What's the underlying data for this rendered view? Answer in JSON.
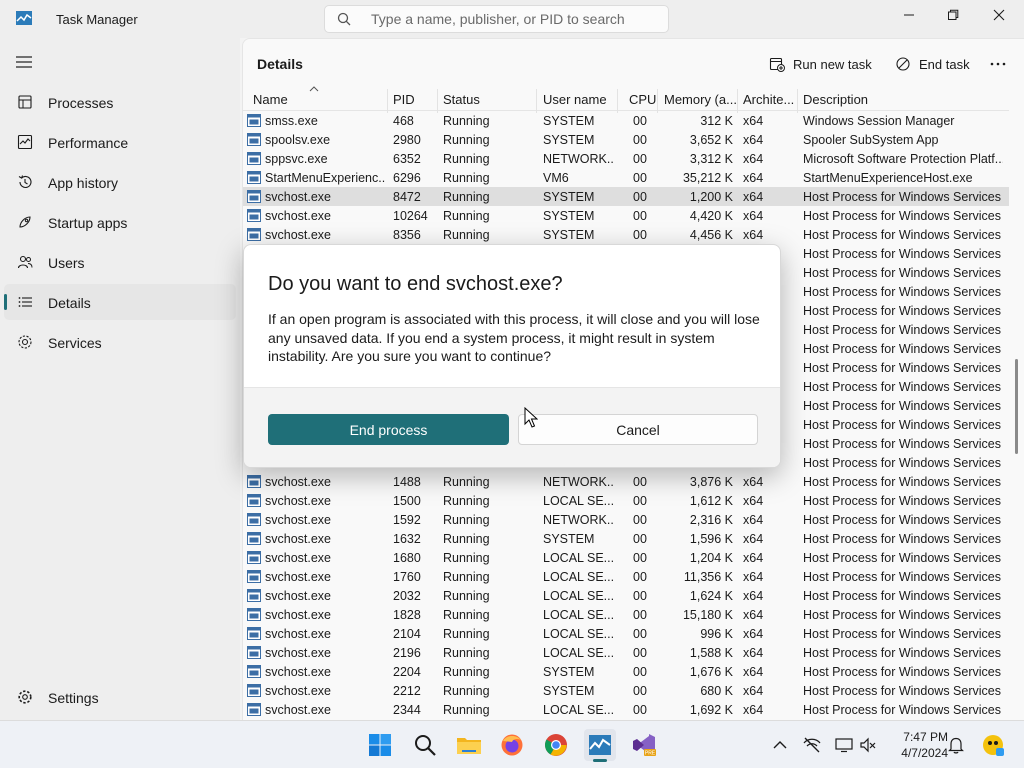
{
  "window": {
    "title": "Task Manager",
    "search_placeholder": "Type a name, publisher, or PID to search"
  },
  "sidebar": {
    "items": [
      {
        "label": "Processes",
        "icon": "processes-icon"
      },
      {
        "label": "Performance",
        "icon": "performance-icon"
      },
      {
        "label": "App history",
        "icon": "history-icon"
      },
      {
        "label": "Startup apps",
        "icon": "startup-icon"
      },
      {
        "label": "Users",
        "icon": "users-icon"
      },
      {
        "label": "Details",
        "icon": "details-icon",
        "active": true
      },
      {
        "label": "Services",
        "icon": "services-icon"
      }
    ],
    "settings_label": "Settings"
  },
  "main": {
    "title": "Details",
    "run_new_task": "Run new task",
    "end_task": "End task"
  },
  "table": {
    "columns": [
      "Name",
      "PID",
      "Status",
      "User name",
      "CPU",
      "Memory (a...",
      "Archite...",
      "Description"
    ],
    "rows": [
      {
        "name": "smss.exe",
        "pid": "468",
        "status": "Running",
        "user": "SYSTEM",
        "cpu": "00",
        "mem": "312 K",
        "arch": "x64",
        "desc": "Windows Session Manager"
      },
      {
        "name": "spoolsv.exe",
        "pid": "2980",
        "status": "Running",
        "user": "SYSTEM",
        "cpu": "00",
        "mem": "3,652 K",
        "arch": "x64",
        "desc": "Spooler SubSystem App"
      },
      {
        "name": "sppsvc.exe",
        "pid": "6352",
        "status": "Running",
        "user": "NETWORK...",
        "cpu": "00",
        "mem": "3,312 K",
        "arch": "x64",
        "desc": "Microsoft Software Protection Platf..."
      },
      {
        "name": "StartMenuExperienc...",
        "pid": "6296",
        "status": "Running",
        "user": "VM6",
        "cpu": "00",
        "mem": "35,212 K",
        "arch": "x64",
        "desc": "StartMenuExperienceHost.exe"
      },
      {
        "name": "svchost.exe",
        "pid": "8472",
        "status": "Running",
        "user": "SYSTEM",
        "cpu": "00",
        "mem": "1,200 K",
        "arch": "x64",
        "desc": "Host Process for Windows Services",
        "selected": true
      },
      {
        "name": "svchost.exe",
        "pid": "10264",
        "status": "Running",
        "user": "SYSTEM",
        "cpu": "00",
        "mem": "4,420 K",
        "arch": "x64",
        "desc": "Host Process for Windows Services"
      },
      {
        "name": "svchost.exe",
        "pid": "8356",
        "status": "Running",
        "user": "SYSTEM",
        "cpu": "00",
        "mem": "4,456 K",
        "arch": "x64",
        "desc": "Host Process for Windows Services"
      },
      {
        "name": "",
        "pid": "",
        "status": "",
        "user": "",
        "cpu": "",
        "mem": "",
        "arch": "",
        "desc": "Host Process for Windows Services"
      },
      {
        "name": "",
        "pid": "",
        "status": "",
        "user": "",
        "cpu": "",
        "mem": "",
        "arch": "",
        "desc": "Host Process for Windows Services"
      },
      {
        "name": "",
        "pid": "",
        "status": "",
        "user": "",
        "cpu": "",
        "mem": "",
        "arch": "",
        "desc": "Host Process for Windows Services"
      },
      {
        "name": "",
        "pid": "",
        "status": "",
        "user": "",
        "cpu": "",
        "mem": "",
        "arch": "",
        "desc": "Host Process for Windows Services"
      },
      {
        "name": "",
        "pid": "",
        "status": "",
        "user": "",
        "cpu": "",
        "mem": "",
        "arch": "",
        "desc": "Host Process for Windows Services"
      },
      {
        "name": "",
        "pid": "",
        "status": "",
        "user": "",
        "cpu": "",
        "mem": "",
        "arch": "",
        "desc": "Host Process for Windows Services"
      },
      {
        "name": "",
        "pid": "",
        "status": "",
        "user": "",
        "cpu": "",
        "mem": "",
        "arch": "",
        "desc": "Host Process for Windows Services"
      },
      {
        "name": "",
        "pid": "",
        "status": "",
        "user": "",
        "cpu": "",
        "mem": "",
        "arch": "",
        "desc": "Host Process for Windows Services"
      },
      {
        "name": "",
        "pid": "",
        "status": "",
        "user": "",
        "cpu": "",
        "mem": "",
        "arch": "",
        "desc": "Host Process for Windows Services"
      },
      {
        "name": "",
        "pid": "",
        "status": "",
        "user": "",
        "cpu": "",
        "mem": "",
        "arch": "",
        "desc": "Host Process for Windows Services"
      },
      {
        "name": "",
        "pid": "",
        "status": "",
        "user": "",
        "cpu": "",
        "mem": "",
        "arch": "",
        "desc": "Host Process for Windows Services"
      },
      {
        "name": "",
        "pid": "",
        "status": "",
        "user": "",
        "cpu": "",
        "mem": "",
        "arch": "",
        "desc": "Host Process for Windows Services"
      },
      {
        "name": "svchost.exe",
        "pid": "1488",
        "status": "Running",
        "user": "NETWORK...",
        "cpu": "00",
        "mem": "3,876 K",
        "arch": "x64",
        "desc": "Host Process for Windows Services"
      },
      {
        "name": "svchost.exe",
        "pid": "1500",
        "status": "Running",
        "user": "LOCAL SE...",
        "cpu": "00",
        "mem": "1,612 K",
        "arch": "x64",
        "desc": "Host Process for Windows Services"
      },
      {
        "name": "svchost.exe",
        "pid": "1592",
        "status": "Running",
        "user": "NETWORK...",
        "cpu": "00",
        "mem": "2,316 K",
        "arch": "x64",
        "desc": "Host Process for Windows Services"
      },
      {
        "name": "svchost.exe",
        "pid": "1632",
        "status": "Running",
        "user": "SYSTEM",
        "cpu": "00",
        "mem": "1,596 K",
        "arch": "x64",
        "desc": "Host Process for Windows Services"
      },
      {
        "name": "svchost.exe",
        "pid": "1680",
        "status": "Running",
        "user": "LOCAL SE...",
        "cpu": "00",
        "mem": "1,204 K",
        "arch": "x64",
        "desc": "Host Process for Windows Services"
      },
      {
        "name": "svchost.exe",
        "pid": "1760",
        "status": "Running",
        "user": "LOCAL SE...",
        "cpu": "00",
        "mem": "11,356 K",
        "arch": "x64",
        "desc": "Host Process for Windows Services"
      },
      {
        "name": "svchost.exe",
        "pid": "2032",
        "status": "Running",
        "user": "LOCAL SE...",
        "cpu": "00",
        "mem": "1,624 K",
        "arch": "x64",
        "desc": "Host Process for Windows Services"
      },
      {
        "name": "svchost.exe",
        "pid": "1828",
        "status": "Running",
        "user": "LOCAL SE...",
        "cpu": "00",
        "mem": "15,180 K",
        "arch": "x64",
        "desc": "Host Process for Windows Services"
      },
      {
        "name": "svchost.exe",
        "pid": "2104",
        "status": "Running",
        "user": "LOCAL SE...",
        "cpu": "00",
        "mem": "996 K",
        "arch": "x64",
        "desc": "Host Process for Windows Services"
      },
      {
        "name": "svchost.exe",
        "pid": "2196",
        "status": "Running",
        "user": "LOCAL SE...",
        "cpu": "00",
        "mem": "1,588 K",
        "arch": "x64",
        "desc": "Host Process for Windows Services"
      },
      {
        "name": "svchost.exe",
        "pid": "2204",
        "status": "Running",
        "user": "SYSTEM",
        "cpu": "00",
        "mem": "1,676 K",
        "arch": "x64",
        "desc": "Host Process for Windows Services"
      },
      {
        "name": "svchost.exe",
        "pid": "2212",
        "status": "Running",
        "user": "SYSTEM",
        "cpu": "00",
        "mem": "680 K",
        "arch": "x64",
        "desc": "Host Process for Windows Services"
      },
      {
        "name": "svchost.exe",
        "pid": "2344",
        "status": "Running",
        "user": "LOCAL SE...",
        "cpu": "00",
        "mem": "1,692 K",
        "arch": "x64",
        "desc": "Host Process for Windows Services"
      }
    ]
  },
  "dialog": {
    "title": "Do you want to end svchost.exe?",
    "body": "If an open program is associated with this process, it will close and you will lose any unsaved data. If you end a system process, it might result in system instability. Are you sure you want to continue?",
    "primary_label": "End process",
    "secondary_label": "Cancel"
  },
  "taskbar": {
    "apps": [
      "windows-start-icon",
      "search-icon",
      "file-explorer-icon",
      "firefox-icon",
      "chrome-icon",
      "task-manager-icon",
      "visual-studio-preview-icon"
    ],
    "time": "7:47 PM",
    "date": "4/7/2024"
  },
  "colors": {
    "accent": "#1f6f78"
  }
}
